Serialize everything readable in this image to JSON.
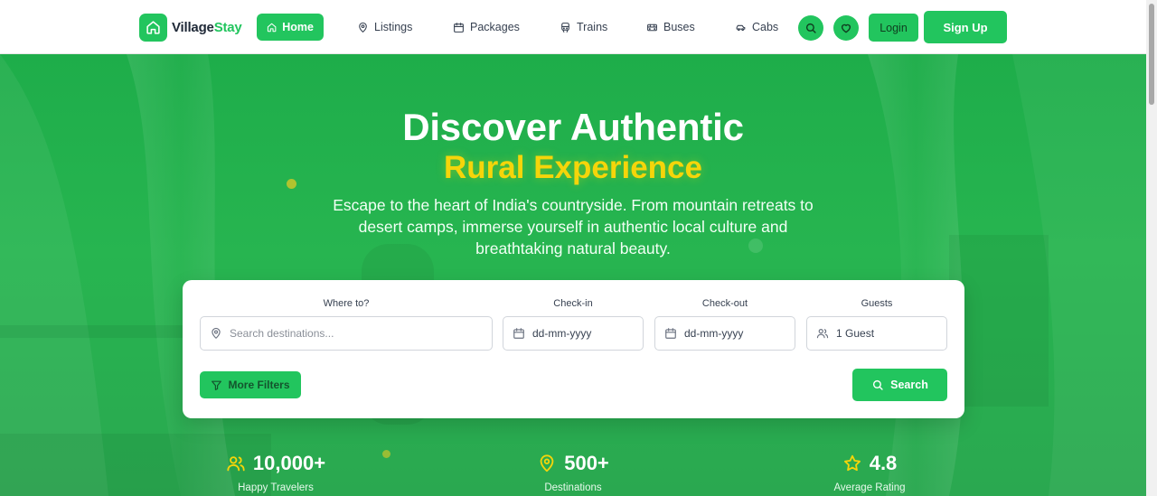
{
  "colors": {
    "primary": "#22c55e",
    "highlight": "#f5d50a",
    "hero_bg": "#27b550"
  },
  "navbar": {
    "brand_prefix": "Village",
    "brand_suffix": "Stay",
    "brand_icon": "home-icon",
    "items": [
      {
        "label": "Home",
        "icon": "home-icon",
        "active": true
      },
      {
        "label": "Listings",
        "icon": "map-pin-icon",
        "active": false
      },
      {
        "label": "Packages",
        "icon": "calendar-icon",
        "active": false
      },
      {
        "label": "Trains",
        "icon": "train-icon",
        "active": false
      },
      {
        "label": "Buses",
        "icon": "bus-icon",
        "active": false
      },
      {
        "label": "Cabs",
        "icon": "car-icon",
        "active": false
      }
    ],
    "search_icon": "search-icon",
    "favorites_icon": "heart-icon",
    "login_label": "Login",
    "signup_label": "Sign Up"
  },
  "hero": {
    "title": "Discover Authentic",
    "highlight": "Rural Experience",
    "subtitle": "Escape to the heart of India's countryside. From mountain retreats to desert camps, immerse yourself in authentic local culture and breathtaking natural beauty."
  },
  "search": {
    "destination_label": "Where to?",
    "destination_placeholder": "Search destinations...",
    "checkin_label": "Check-in",
    "checkin_value": "dd-mm-yyyy",
    "checkout_label": "Check-out",
    "checkout_value": "dd-mm-yyyy",
    "guests_label": "Guests",
    "guests_value": "1 Guest",
    "filters_label": "More Filters",
    "search_label": "Search"
  },
  "stats": [
    {
      "value": "10,000+",
      "label": "Happy Travelers",
      "icon": "users-icon"
    },
    {
      "value": "500+",
      "label": "Destinations",
      "icon": "map-pin-icon"
    },
    {
      "value": "4.8",
      "label": "Average Rating",
      "icon": "star-icon"
    }
  ]
}
